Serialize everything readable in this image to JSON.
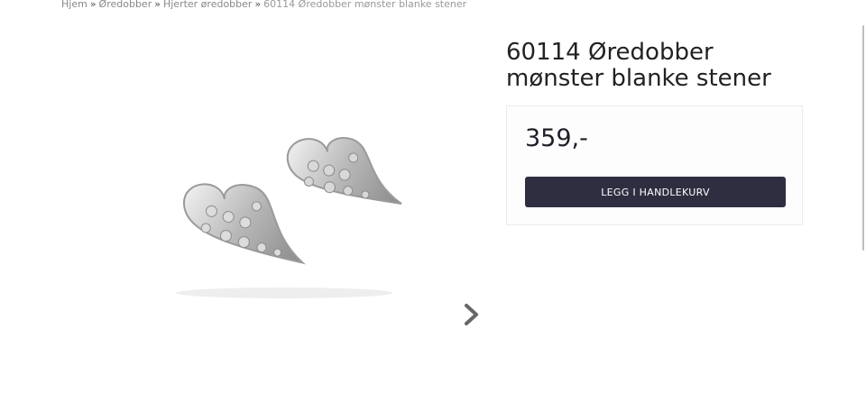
{
  "breadcrumb": {
    "items": [
      "Hjem",
      "Øredobber",
      "Hjerter øredobber"
    ],
    "separator": "»",
    "current": "60114 Øredobber mønster blanke stener"
  },
  "product": {
    "title": "60114 Øredobber mønster blanke stener",
    "price": "359,-",
    "add_to_cart_label": "LEGG I HANDLEKURV",
    "image_alt_icon": "heart-earrings-image"
  },
  "gallery": {
    "next_icon": "chevron-right-icon"
  },
  "colors": {
    "button_bg": "#2f2e40",
    "button_text": "#ffffff",
    "title_text": "#222222",
    "breadcrumb_text": "#888888"
  }
}
